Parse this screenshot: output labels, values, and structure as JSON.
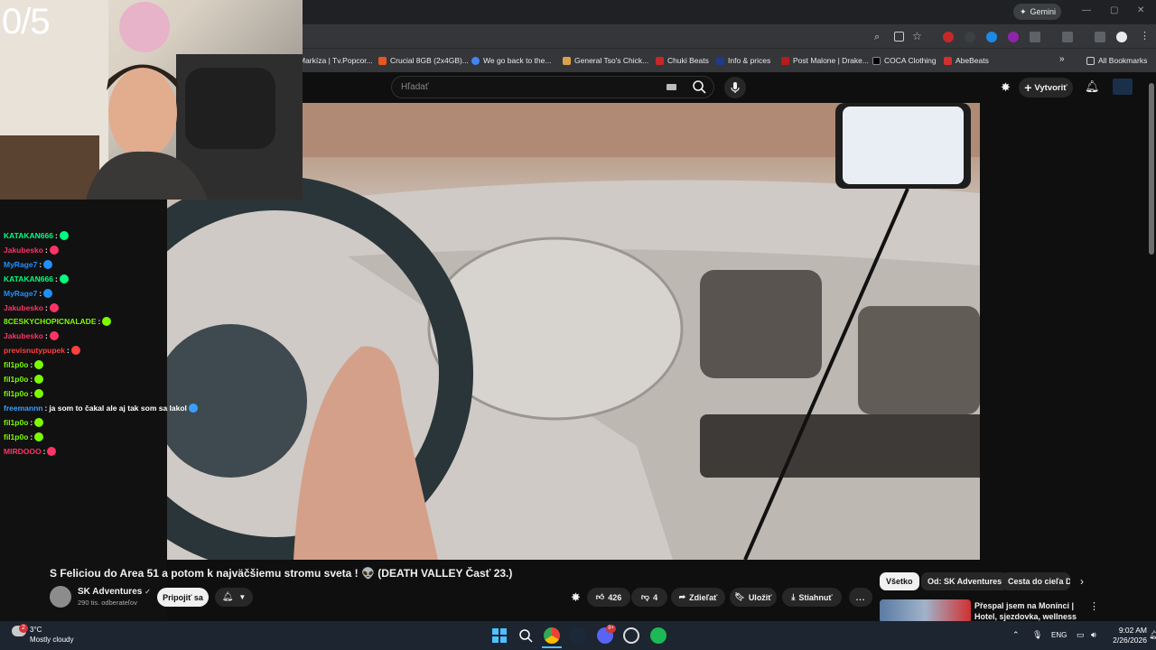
{
  "stream": {
    "counter": "0/5"
  },
  "browser": {
    "gemini_label": "Gemini",
    "bookmarks": [
      {
        "label": "Markíza | Tv.Popcor...",
        "color": "#1a1a1a"
      },
      {
        "label": "Crucial 8GB (2x4GB)...",
        "color": "#e8571c"
      },
      {
        "label": "We go back to the...",
        "color": "#4285f4"
      },
      {
        "label": "General Tso's Chick...",
        "color": "#d8a24b"
      },
      {
        "label": "Chuki Beats",
        "color": "#c62828"
      },
      {
        "label": "Info & prices",
        "color": "#1e3a8a"
      },
      {
        "label": "Post Malone | Drake...",
        "color": "#b71c1c"
      },
      {
        "label": "COCA Clothing",
        "color": "#000000"
      },
      {
        "label": "AbeBeats",
        "color": "#d32f2f"
      }
    ],
    "more_bookmarks": "»",
    "all_bookmarks": "All Bookmarks"
  },
  "youtube": {
    "search_placeholder": "Hľadať",
    "create_label": "Vytvoriť",
    "video": {
      "title": "S Feliciou do Area 51 a potom k najväčšiemu stromu sveta ! 👽 (DEATH VALLEY Časť 23.)",
      "channel": "SK Adventures",
      "subscribers": "290 tis. odberateľov",
      "join_label": "Pripojiť sa",
      "likes": "426",
      "dislikes": "4",
      "share_label": "Zdieľať",
      "save_label": "Uložiť",
      "download_label": "Stiahnuť",
      "more_label": "..."
    },
    "chips": [
      "Všetko",
      "Od: SK Adventures",
      "Cesta do cieľa Do"
    ],
    "recommendation": {
      "title": "Přespal jsem na Monínci | Hotel, sjezdovka, wellness"
    }
  },
  "chat": [
    {
      "user": "KATAKAN666",
      "color": "#00ff7f",
      "msg": ""
    },
    {
      "user": "Jakubesko",
      "color": "#ff3366",
      "msg": ""
    },
    {
      "user": "MyRage7",
      "color": "#1e90ff",
      "msg": ""
    },
    {
      "user": "KATAKAN666",
      "color": "#00ff7f",
      "msg": ""
    },
    {
      "user": "MyRage7",
      "color": "#1e90ff",
      "msg": ""
    },
    {
      "user": "Jakubesko",
      "color": "#ff3366",
      "msg": ""
    },
    {
      "user": "8CESKYCHOPICNALADE",
      "color": "#7cfc00",
      "msg": ""
    },
    {
      "user": "Jakubesko",
      "color": "#ff3366",
      "msg": ""
    },
    {
      "user": "previsnutypupek",
      "color": "#ff4040",
      "msg": ""
    },
    {
      "user": "fil1p0o",
      "color": "#7cfc00",
      "msg": ""
    },
    {
      "user": "fil1p0o",
      "color": "#7cfc00",
      "msg": ""
    },
    {
      "user": "fil1p0o",
      "color": "#7cfc00",
      "msg": ""
    },
    {
      "user": "freemannn",
      "color": "#3aa0ff",
      "msg": "ja som to čakal ale aj tak som sa lakol"
    },
    {
      "user": "fil1p0o",
      "color": "#7cfc00",
      "msg": ""
    },
    {
      "user": "fil1p0o",
      "color": "#7cfc00",
      "msg": ""
    },
    {
      "user": "MIRDOOO",
      "color": "#ff3366",
      "msg": ""
    }
  ],
  "taskbar": {
    "weather_temp": "3°C",
    "weather_desc": "Mostly cloudy",
    "weather_badge": "2",
    "lang": "ENG",
    "time": "9:02 AM",
    "date": "2/26/2026",
    "discord_badge": "9+"
  }
}
